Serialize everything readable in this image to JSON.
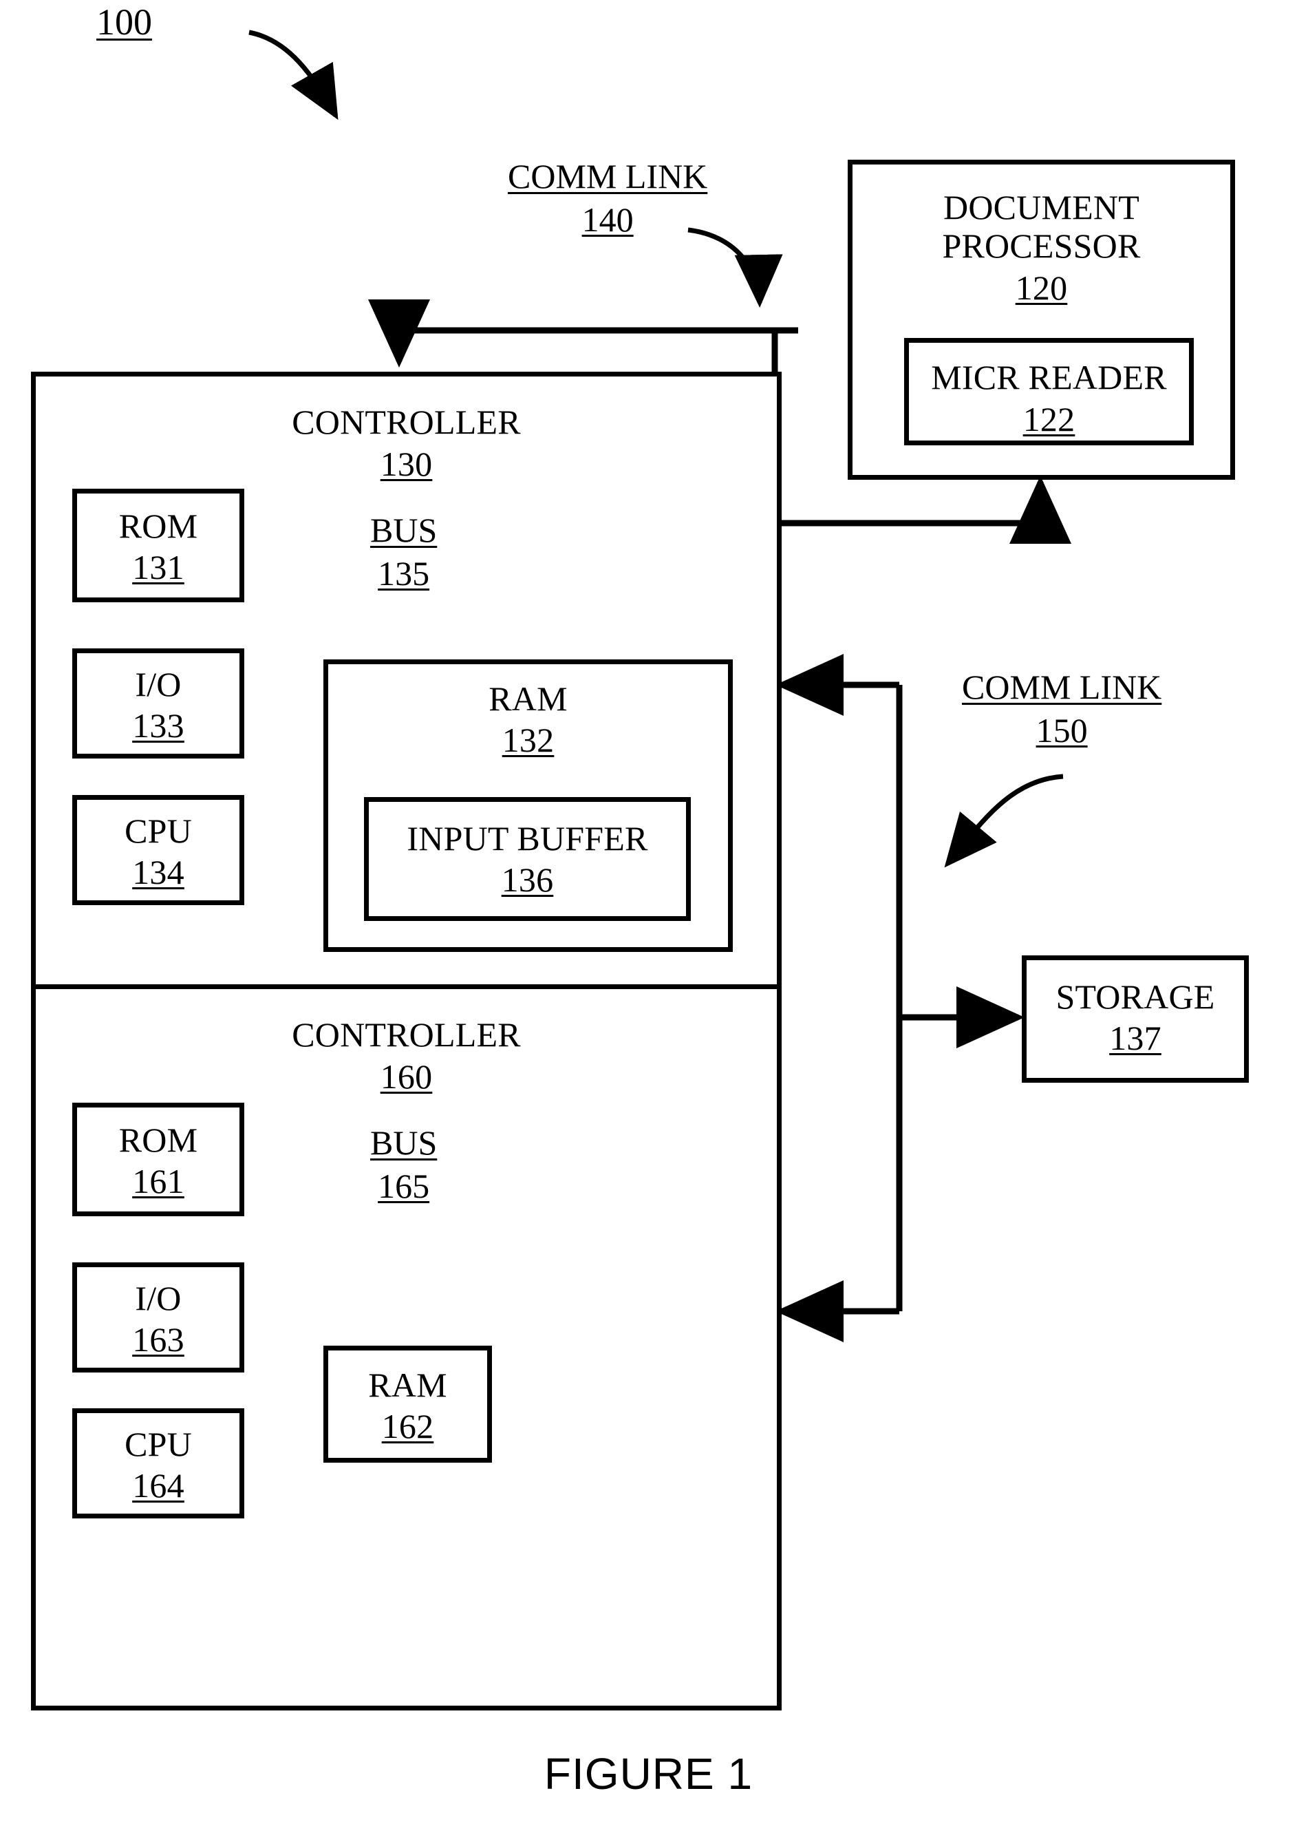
{
  "figure": {
    "caption": "FIGURE 1",
    "system_ref": "100"
  },
  "labels": {
    "comm_link_140": {
      "name": "COMM LINK",
      "ref": "140"
    },
    "comm_link_150": {
      "name": "COMM LINK",
      "ref": "150"
    },
    "bus_135": {
      "name": "BUS",
      "ref": "135"
    },
    "bus_165": {
      "name": "BUS",
      "ref": "165"
    }
  },
  "blocks": {
    "document_processor": {
      "name_line1": "DOCUMENT",
      "name_line2": "PROCESSOR",
      "ref": "120"
    },
    "micr_reader": {
      "name": "MICR READER",
      "ref": "122"
    },
    "controller_130": {
      "name": "CONTROLLER",
      "ref": "130"
    },
    "rom_131": {
      "name": "ROM",
      "ref": "131"
    },
    "io_133": {
      "name": "I/O",
      "ref": "133"
    },
    "cpu_134": {
      "name": "CPU",
      "ref": "134"
    },
    "ram_132": {
      "name": "RAM",
      "ref": "132"
    },
    "input_buffer_136": {
      "name": "INPUT BUFFER",
      "ref": "136"
    },
    "storage_137": {
      "name": "STORAGE",
      "ref": "137"
    },
    "controller_160": {
      "name": "CONTROLLER",
      "ref": "160"
    },
    "rom_161": {
      "name": "ROM",
      "ref": "161"
    },
    "io_163": {
      "name": "I/O",
      "ref": "163"
    },
    "cpu_164": {
      "name": "CPU",
      "ref": "164"
    },
    "ram_162": {
      "name": "RAM",
      "ref": "162"
    }
  },
  "colors": {
    "ink": "#000000",
    "paper": "#ffffff"
  },
  "chart_data": {
    "type": "diagram",
    "title": "FIGURE 1",
    "nodes": [
      {
        "id": "120",
        "label": "DOCUMENT PROCESSOR",
        "ref": "120"
      },
      {
        "id": "122",
        "label": "MICR READER",
        "ref": "122",
        "parent": "120"
      },
      {
        "id": "130",
        "label": "CONTROLLER",
        "ref": "130"
      },
      {
        "id": "131",
        "label": "ROM",
        "ref": "131",
        "parent": "130"
      },
      {
        "id": "132",
        "label": "RAM",
        "ref": "132",
        "parent": "130"
      },
      {
        "id": "133",
        "label": "I/O",
        "ref": "133",
        "parent": "130"
      },
      {
        "id": "134",
        "label": "CPU",
        "ref": "134",
        "parent": "130"
      },
      {
        "id": "135",
        "label": "BUS",
        "ref": "135",
        "parent": "130"
      },
      {
        "id": "136",
        "label": "INPUT BUFFER",
        "ref": "136",
        "parent": "132"
      },
      {
        "id": "137",
        "label": "STORAGE",
        "ref": "137"
      },
      {
        "id": "160",
        "label": "CONTROLLER",
        "ref": "160"
      },
      {
        "id": "161",
        "label": "ROM",
        "ref": "161",
        "parent": "160"
      },
      {
        "id": "162",
        "label": "RAM",
        "ref": "162",
        "parent": "160"
      },
      {
        "id": "163",
        "label": "I/O",
        "ref": "163",
        "parent": "160"
      },
      {
        "id": "164",
        "label": "CPU",
        "ref": "164",
        "parent": "160"
      },
      {
        "id": "165",
        "label": "BUS",
        "ref": "165",
        "parent": "160"
      }
    ],
    "edges": [
      {
        "from": "120",
        "to": "130",
        "label": "COMM LINK",
        "ref": "140",
        "direction": "both"
      },
      {
        "from": "137",
        "to": "130",
        "label": "COMM LINK",
        "ref": "150",
        "direction": "both"
      },
      {
        "from": "137",
        "to": "160",
        "label": "COMM LINK",
        "ref": "150",
        "direction": "both"
      }
    ]
  }
}
